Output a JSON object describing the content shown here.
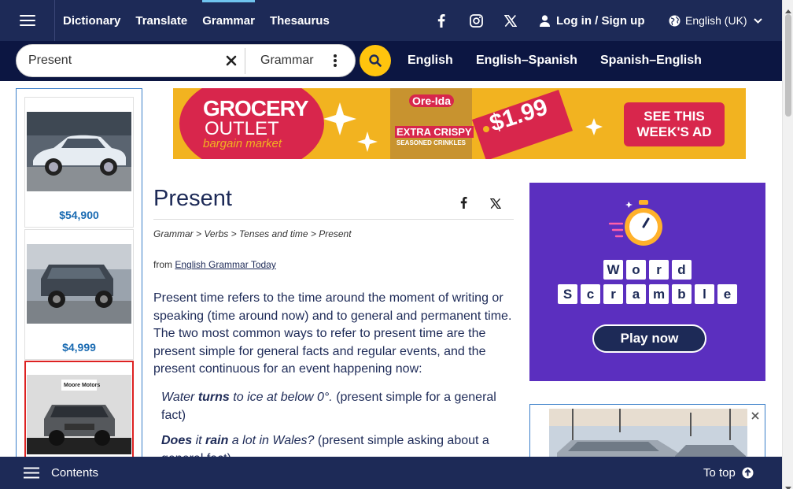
{
  "nav": {
    "links": [
      "Dictionary",
      "Translate",
      "Grammar",
      "Thesaurus"
    ],
    "active": "Grammar",
    "login_label": "Log in / Sign up",
    "language_label": "English (UK)"
  },
  "search": {
    "value": "Present",
    "dictionary_selected": "Grammar",
    "dictionary_links": [
      "English",
      "English–Spanish",
      "Spanish–English"
    ]
  },
  "left_ad": {
    "prices": [
      "$54,900",
      "$4,999"
    ],
    "dealer_logo": "Moore Motors"
  },
  "banner": {
    "brand_line1": "GROCERY",
    "brand_line2": "OUTLET",
    "brand_line3": "bargain market",
    "product_brand": "Ore-Ida",
    "product_line1": "EXTRA CRISPY",
    "product_line2": "SEASONED CRINKLES",
    "price": "$1.99",
    "cta_line1": "SEE THIS",
    "cta_line2": "WEEK'S AD"
  },
  "article": {
    "title": "Present",
    "breadcrumb": "Grammar > Verbs > Tenses and time > Present",
    "from_prefix": "from ",
    "from_link": "English Grammar Today",
    "intro": "Present time refers to the time around the moment of writing or speaking (time around now) and to general and permanent time. The two most common ways to refer to present time are the present simple for general facts and regular events, and the present continuous for an event happening now:",
    "ex1_pre": "Water ",
    "ex1_bold": "turns",
    "ex1_post": " to ice at below 0°.",
    "ex1_note": " (present simple for a general fact)",
    "ex2_bold1": "Does",
    "ex2_mid": " it ",
    "ex2_bold2": "rain",
    "ex2_post": " a lot in Wales?",
    "ex2_note": " (present simple asking about a general fact)"
  },
  "word_scramble": {
    "row1": [
      "W",
      "o",
      "r",
      "d"
    ],
    "row2": [
      "S",
      "c",
      "r",
      "a",
      "m",
      "b",
      "l",
      "e"
    ],
    "button": "Play now"
  },
  "bottom": {
    "contents_label": "Contents",
    "to_top_label": "To top"
  },
  "colors": {
    "nav_bg": "#1d2a57",
    "search_bg": "#0c1642",
    "accent_yellow": "#ffc40d",
    "price_blue": "#1a6bb2",
    "scramble_purple": "#5b2fbf"
  }
}
